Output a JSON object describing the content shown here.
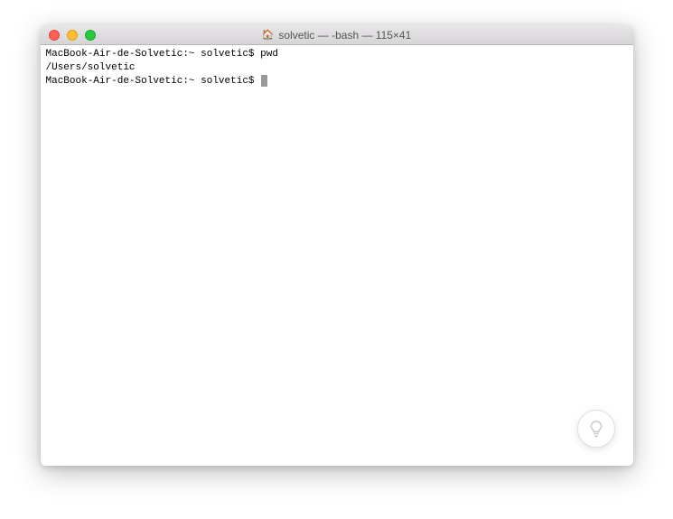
{
  "window": {
    "title_icon": "🏠",
    "title": "solvetic — -bash — 115×41"
  },
  "terminal": {
    "lines": [
      {
        "prompt": "MacBook-Air-de-Solvetic:~ solvetic$ ",
        "command": "pwd"
      },
      {
        "output": "/Users/solvetic"
      },
      {
        "prompt": "MacBook-Air-de-Solvetic:~ solvetic$ ",
        "command": "",
        "cursor": true
      }
    ]
  }
}
